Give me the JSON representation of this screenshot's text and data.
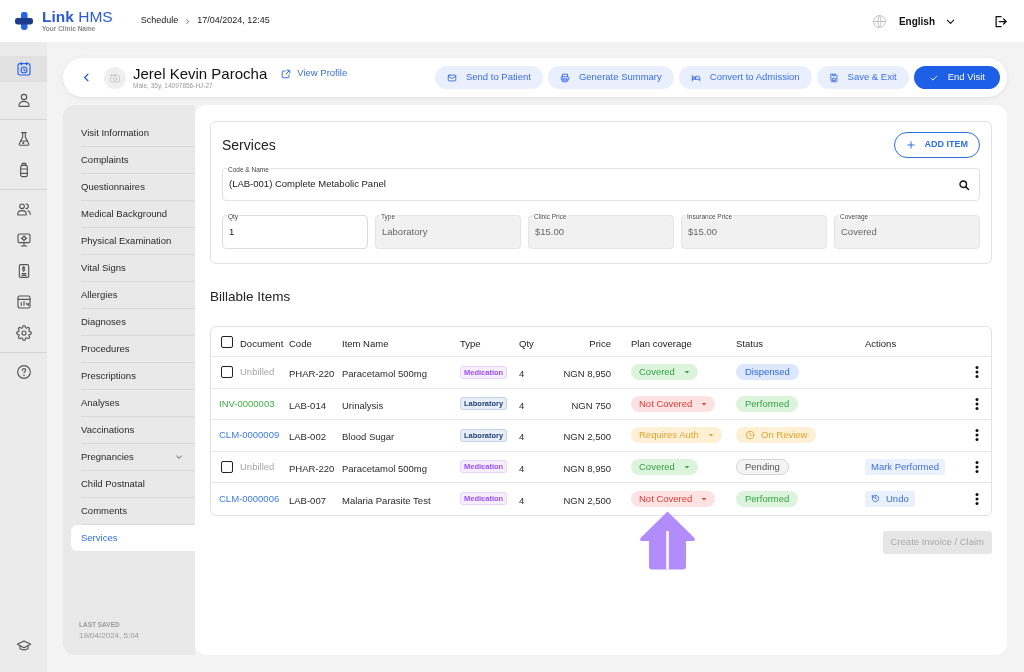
{
  "header": {
    "logo": {
      "name": "**Link** HMS",
      "tagline": "Your Clinic Name"
    },
    "breadcrumb": [
      "Schedule",
      "17/04/2024, 12:45"
    ],
    "language": "English"
  },
  "nav_rail": {
    "groups": [
      [
        {
          "selected": true
        },
        {
          "selected": false
        }
      ],
      [
        {
          "selected": false
        },
        {
          "selected": false
        }
      ],
      [
        {
          "selected": false
        },
        {
          "selected": false
        },
        {
          "selected": false
        },
        {
          "selected": false
        },
        {
          "selected": false
        }
      ],
      [
        {
          "selected": false
        }
      ]
    ],
    "footer": [
      {
        "selected": false
      }
    ]
  },
  "patient": {
    "name": "Jerel Kevin Parocha",
    "details": "Male, 35y, 14097856-HJ-27",
    "profile_link": "View Profile"
  },
  "visit_actions": [
    {
      "label": "Send to Patient",
      "kind": "send",
      "primary": false
    },
    {
      "label": "Generate Summary",
      "kind": "summary",
      "primary": false
    },
    {
      "label": "Convert to Admission",
      "kind": "admission",
      "primary": false
    },
    {
      "label": "Save & Exit",
      "kind": "save",
      "primary": false
    },
    {
      "label": "End Visit",
      "kind": "end",
      "primary": true
    }
  ],
  "sidebar": {
    "items": [
      {
        "label": "Visit Information",
        "kind": "item",
        "selected": false
      },
      {
        "label": "Complaints",
        "kind": "item",
        "selected": false
      },
      {
        "label": "Questionnaires",
        "kind": "item",
        "selected": false
      },
      {
        "label": "Medical Background",
        "kind": "item",
        "selected": false
      },
      {
        "label": "Physical Examination",
        "kind": "item",
        "selected": false
      },
      {
        "label": "Vital Signs",
        "kind": "item",
        "selected": false
      },
      {
        "label": "Allergies",
        "kind": "item",
        "selected": false
      },
      {
        "label": "Diagnoses",
        "kind": "item",
        "selected": false
      },
      {
        "label": "Procedures",
        "kind": "item",
        "selected": false
      },
      {
        "label": "Prescriptions",
        "kind": "item",
        "selected": false
      },
      {
        "label": "Analyses",
        "kind": "item",
        "selected": false
      },
      {
        "label": "Vaccinations",
        "kind": "item",
        "selected": false
      },
      {
        "label": "Pregnancies",
        "kind": "group",
        "selected": false
      },
      {
        "label": "Child Postnatal",
        "kind": "item",
        "selected": false
      },
      {
        "label": "Comments",
        "kind": "item",
        "selected": false
      },
      {
        "label": "Services",
        "kind": "item",
        "selected": true
      }
    ],
    "last_saved": {
      "label": "LAST SAVED",
      "value": "19/04/2024, 5:04"
    }
  },
  "services": {
    "title": "Services",
    "add_button": "ADD ITEM",
    "code_field": {
      "label": "Code & Name",
      "value": "(LAB-001) Complete Metabolic Panel"
    },
    "fields": [
      {
        "label": "Qty",
        "value": "1",
        "disabled": false
      },
      {
        "label": "Type",
        "value": "Laboratory",
        "disabled": true
      },
      {
        "label": "Clinic Price",
        "value": "$15.00",
        "disabled": true
      },
      {
        "label": "Insurance Price",
        "value": "$15.00",
        "disabled": true
      },
      {
        "label": "Coverage",
        "value": "Covered",
        "disabled": true
      }
    ]
  },
  "billable_items": {
    "title": "Billable Items",
    "select_all": {
      "checked": false
    },
    "columns": [
      "Document",
      "Code",
      "Item Name",
      "Type",
      "Qty",
      "Price",
      "Plan coverage",
      "Status",
      "Actions"
    ],
    "rows": [
      {
        "document": {
          "text": "Unbilled",
          "kind": "unbilled",
          "checked": false
        },
        "code": "PHAR-220",
        "item_name": "Paracetamol 500mg",
        "type": {
          "label": "Medication",
          "kind": "medication"
        },
        "qty": "4",
        "price": "NGN 8,950",
        "coverage": {
          "label": "Covered",
          "kind": "covered"
        },
        "status": {
          "label": "Dispensed",
          "kind": "dispensed"
        }
      },
      {
        "document": {
          "text": "INV-0000003",
          "kind": "invoice"
        },
        "code": "LAB-014",
        "item_name": "Urinalysis",
        "type": {
          "label": "Laboratory",
          "kind": "laboratory"
        },
        "qty": "4",
        "price": "NGN 750",
        "coverage": {
          "label": "Not Covered",
          "kind": "not_covered"
        },
        "status": {
          "label": "Performed",
          "kind": "performed"
        }
      },
      {
        "document": {
          "text": "CLM-0000009",
          "kind": "claim"
        },
        "code": "LAB-002",
        "item_name": "Blood Sugar",
        "type": {
          "label": "Laboratory",
          "kind": "laboratory"
        },
        "qty": "4",
        "price": "NGN 2,500",
        "coverage": {
          "label": "Requires Auth",
          "kind": "requires_auth"
        },
        "status": {
          "label": "On Review",
          "kind": "on_review"
        }
      },
      {
        "document": {
          "text": "Unbilled",
          "kind": "unbilled",
          "checked": false
        },
        "code": "PHAR-220",
        "item_name": "Paracetamol 500mg",
        "type": {
          "label": "Medication",
          "kind": "medication"
        },
        "qty": "4",
        "price": "NGN 8,950",
        "coverage": {
          "label": "Covered",
          "kind": "covered"
        },
        "status": {
          "label": "Pending",
          "kind": "pending"
        },
        "action": {
          "label": "Mark Performed",
          "kind": "mark"
        }
      },
      {
        "document": {
          "text": "CLM-0000006",
          "kind": "claim"
        },
        "code": "LAB-007",
        "item_name": "Malaria Parasite Test",
        "type": {
          "label": "Medication",
          "kind": "medication"
        },
        "qty": "4",
        "price": "NGN 2,500",
        "coverage": {
          "label": "Not Covered",
          "kind": "not_covered"
        },
        "status": {
          "label": "Performed",
          "kind": "performed"
        },
        "action": {
          "label": "Undo",
          "kind": "undo"
        }
      }
    ],
    "create_button": {
      "label": "Create Invoice / Claim",
      "disabled": true
    }
  }
}
